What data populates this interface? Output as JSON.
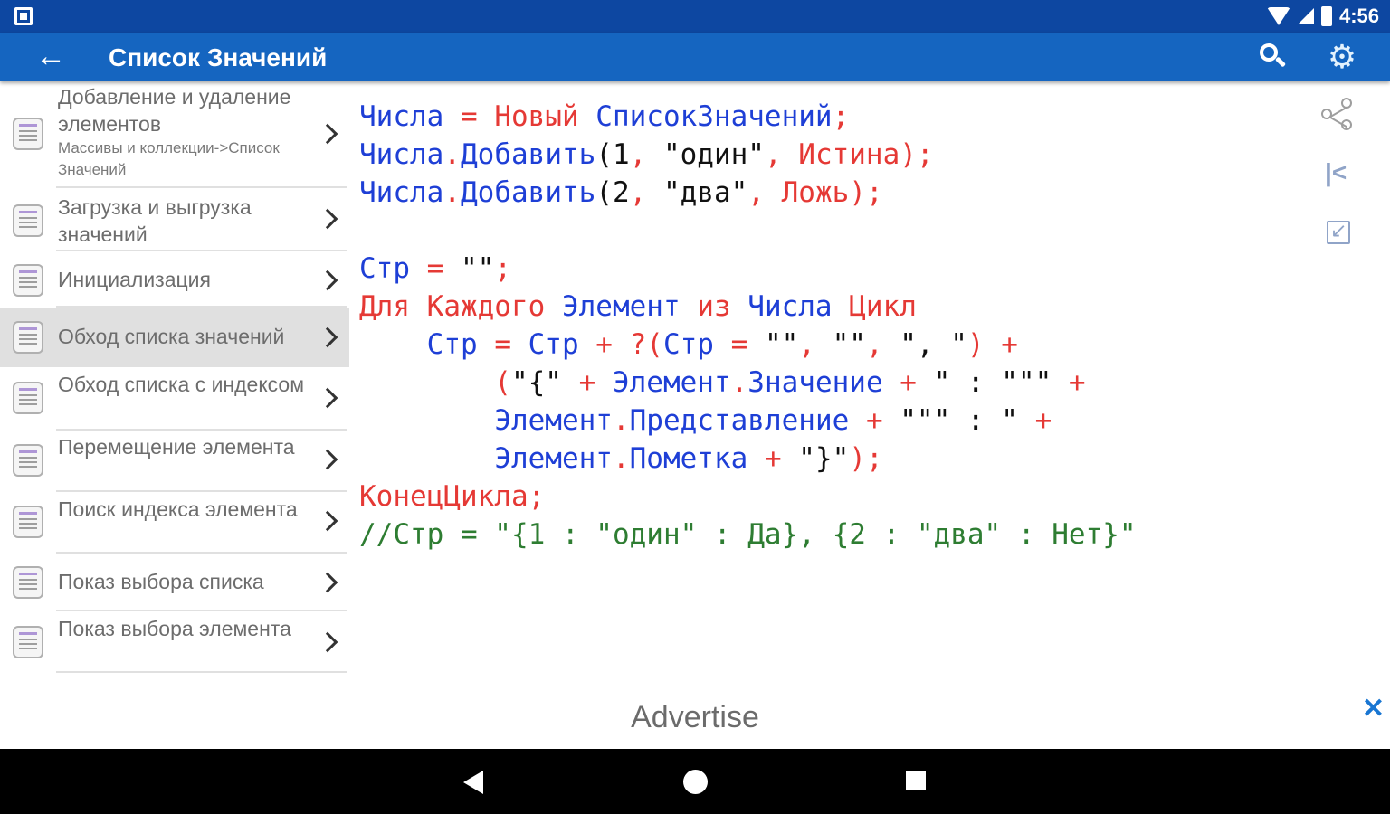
{
  "status_bar": {
    "time": "4:56"
  },
  "app_bar": {
    "title": "Список Значений",
    "back_icon": "arrow-left-icon",
    "search_icon": "search-icon",
    "settings_icon": "gear-icon"
  },
  "sidebar": {
    "items": [
      {
        "label": "Добавление и удаление элементов",
        "sub": "Массивы и коллекции->Список Значений"
      },
      {
        "label": "Загрузка и выгрузка значений"
      },
      {
        "label": "Инициализация"
      },
      {
        "label": "Обход списка значений"
      },
      {
        "label": "Обход списка с индексом"
      },
      {
        "label": "Перемещение элемента"
      },
      {
        "label": "Поиск индекса элемента"
      },
      {
        "label": "Показ выбора списка"
      },
      {
        "label": "Показ выбора элемента"
      }
    ]
  },
  "code": {
    "lines": [
      [
        [
          "id",
          "Числа "
        ],
        [
          "kw",
          "= "
        ],
        [
          "kw",
          "Новый "
        ],
        [
          "id",
          "СписокЗначений"
        ],
        [
          "kw",
          ";"
        ]
      ],
      [
        [
          "id",
          "Числа"
        ],
        [
          "kw",
          "."
        ],
        [
          "id",
          "Добавить"
        ],
        [
          "st",
          "(1"
        ],
        [
          "kw",
          ", "
        ],
        [
          "st",
          "\"один\""
        ],
        [
          "kw",
          ", "
        ],
        [
          "kw",
          "Истина"
        ],
        [
          "kw",
          ");"
        ]
      ],
      [
        [
          "id",
          "Числа"
        ],
        [
          "kw",
          "."
        ],
        [
          "id",
          "Добавить"
        ],
        [
          "st",
          "(2"
        ],
        [
          "kw",
          ", "
        ],
        [
          "st",
          "\"два\""
        ],
        [
          "kw",
          ", "
        ],
        [
          "kw",
          "Ложь"
        ],
        [
          "kw",
          ");"
        ]
      ],
      [],
      [
        [
          "id",
          "Стр "
        ],
        [
          "kw",
          "= "
        ],
        [
          "st",
          "\"\""
        ],
        [
          "kw",
          ";"
        ]
      ],
      [
        [
          "kw",
          "Для "
        ],
        [
          "kw",
          "Каждого "
        ],
        [
          "id",
          "Элемент "
        ],
        [
          "kw",
          "из "
        ],
        [
          "id",
          "Числа "
        ],
        [
          "kw",
          "Цикл"
        ]
      ],
      [
        [
          "st",
          "    "
        ],
        [
          "id",
          "Стр "
        ],
        [
          "kw",
          "= "
        ],
        [
          "id",
          "Стр "
        ],
        [
          "kw",
          "+ ?"
        ],
        [
          "kw",
          "("
        ],
        [
          "id",
          "Стр "
        ],
        [
          "kw",
          "= "
        ],
        [
          "st",
          "\"\""
        ],
        [
          "kw",
          ", "
        ],
        [
          "st",
          "\"\""
        ],
        [
          "kw",
          ", "
        ],
        [
          "st",
          "\", \""
        ],
        [
          "kw",
          ") +"
        ]
      ],
      [
        [
          "st",
          "        "
        ],
        [
          "kw",
          "("
        ],
        [
          "st",
          "\"{\" "
        ],
        [
          "kw",
          "+ "
        ],
        [
          "id",
          "Элемент"
        ],
        [
          "kw",
          "."
        ],
        [
          "id",
          "Значение "
        ],
        [
          "kw",
          "+ "
        ],
        [
          "st",
          "\" : \"\"\" "
        ],
        [
          "kw",
          "+"
        ]
      ],
      [
        [
          "st",
          "        "
        ],
        [
          "id",
          "Элемент"
        ],
        [
          "kw",
          "."
        ],
        [
          "id",
          "Представление "
        ],
        [
          "kw",
          "+ "
        ],
        [
          "st",
          "\"\"\" : \" "
        ],
        [
          "kw",
          "+"
        ]
      ],
      [
        [
          "st",
          "        "
        ],
        [
          "id",
          "Элемент"
        ],
        [
          "kw",
          "."
        ],
        [
          "id",
          "Пометка "
        ],
        [
          "kw",
          "+ "
        ],
        [
          "st",
          "\"}\""
        ],
        [
          "kw",
          ");"
        ]
      ],
      [
        [
          "kw",
          "КонецЦикла"
        ],
        [
          "kw",
          ";"
        ]
      ],
      [
        [
          "cm",
          "//Стр = \"{1 : \"один\" : Да}, {2 : \"два\" : Нет}\""
        ]
      ]
    ]
  },
  "side_tools": {
    "share_icon": "share-icon",
    "first_icon": "skip-to-start-icon",
    "collapse_icon": "collapse-icon"
  },
  "advert": {
    "text": "Advertise",
    "close": "✕"
  },
  "nav_bar": {
    "back_icon": "nav-back-icon",
    "home_icon": "nav-home-icon",
    "recent_icon": "nav-recent-icon"
  }
}
